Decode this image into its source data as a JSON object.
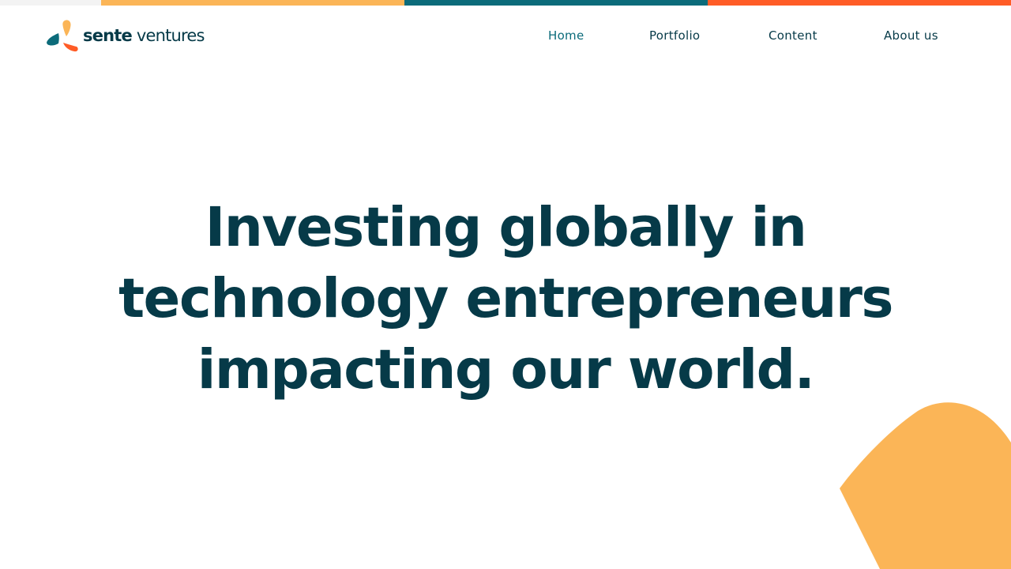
{
  "colors": {
    "stripe_light": "#f3f3f3",
    "stripe_yellow": "#fbb557",
    "stripe_teal": "#0c6b7a",
    "stripe_orange": "#ff5c26",
    "text_dark": "#063a48",
    "nav_active": "#0b6b7a",
    "blob": "#fbb557"
  },
  "brand": {
    "name_bold": "sente",
    "name_light": " ventures",
    "logo_icon": "sente-logo-icon"
  },
  "nav": {
    "items": [
      {
        "label": "Home",
        "active": true
      },
      {
        "label": "Portfolio",
        "active": false
      },
      {
        "label": "Content",
        "active": false
      },
      {
        "label": "About us",
        "active": false
      }
    ]
  },
  "hero": {
    "lines": [
      "Investing globally in",
      "technology entrepreneurs",
      "impacting our world."
    ]
  }
}
